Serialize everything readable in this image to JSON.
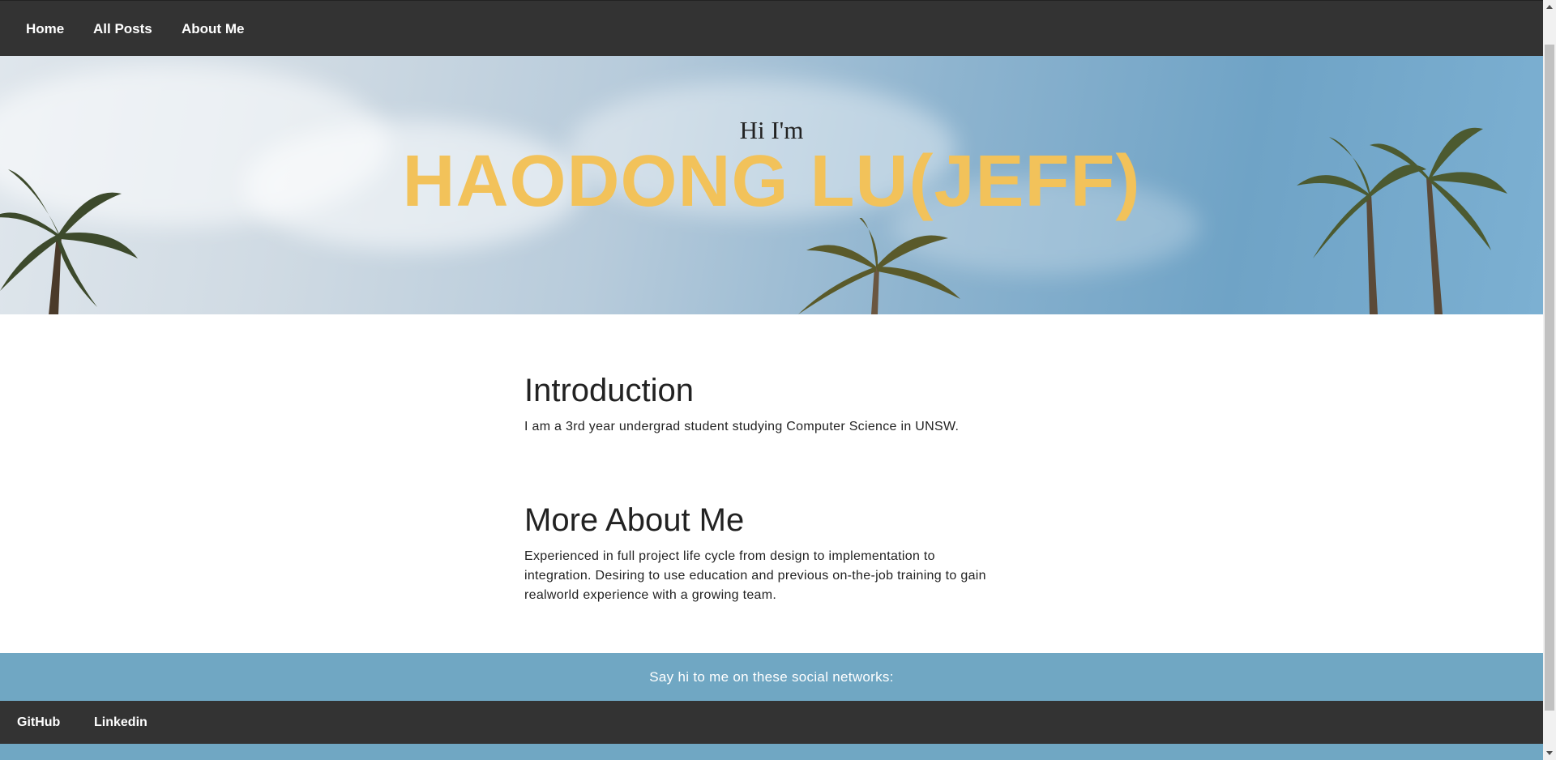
{
  "nav": {
    "home": "Home",
    "all_posts": "All Posts",
    "about_me": "About Me"
  },
  "hero": {
    "greeting": "Hi I'm",
    "name": "HAODONG LU(JEFF)"
  },
  "sections": {
    "introduction": {
      "title": "Introduction",
      "text": "I am a 3rd year undergrad student studying Computer Science in UNSW."
    },
    "more_about_me": {
      "title": "More About Me",
      "text": "Experienced in full project life cycle from design to implementation to integration. Desiring to use education and previous on-the-job training to gain realworld experience with a growing team."
    }
  },
  "footer": {
    "social_prompt": "Say hi to me on these social networks:",
    "links": {
      "github": "GitHub",
      "linkedin": "Linkedin"
    }
  },
  "colors": {
    "nav_bg": "#333333",
    "name_accent": "#f2c25a",
    "footer_band": "#70a7c3"
  }
}
